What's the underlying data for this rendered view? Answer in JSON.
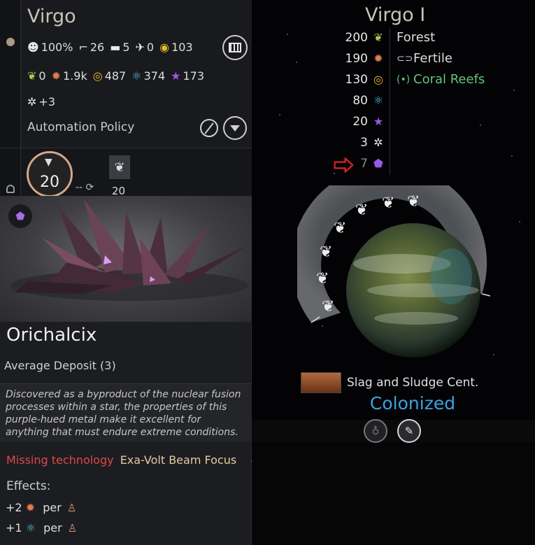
{
  "system": {
    "name": "Virgo",
    "stats_row1": {
      "approval": "100%",
      "land_units": "26",
      "tanks": "5",
      "air": "0",
      "influence_pool": "103"
    },
    "stats_row2": {
      "food": "0",
      "industry": "1.9k",
      "dust": "487",
      "science": "374",
      "influence": "173"
    },
    "stats_row3": {
      "stability": "+3"
    },
    "automation_label": "Automation Policy",
    "icons": [
      "approval-icon",
      "land-unit-icon",
      "tank-icon",
      "air-unit-icon",
      "influence-pool-icon",
      "construction-icon",
      "cancel-icon",
      "dropdown-icon"
    ]
  },
  "population": {
    "value": "20",
    "rate": "--",
    "faction_count": "20"
  },
  "resource": {
    "name": "Orichalcix",
    "deposit": "Average Deposit (3)",
    "description": "Discovered as a byproduct of the nuclear fusion processes within a star, the properties of this purple-hued metal make it excellent for anything that must endure extreme conditions.",
    "missing_label": "Missing technology",
    "missing_tech": "Exa-Volt Beam Focus",
    "effects_label": "Effects:",
    "effects": [
      {
        "amount": "+2",
        "resource_icon": "industry-icon",
        "per": "per"
      },
      {
        "amount": "+1",
        "resource_icon": "science-icon",
        "per": "per"
      }
    ]
  },
  "planet": {
    "name": "Virgo I",
    "yields": [
      {
        "value": "200",
        "icon": "food-icon",
        "color": "#a8c950"
      },
      {
        "value": "190",
        "icon": "industry-icon",
        "color": "#e07b52"
      },
      {
        "value": "130",
        "icon": "dust-icon",
        "color": "#e7b62d"
      },
      {
        "value": "80",
        "icon": "science-icon",
        "color": "#4ec2da"
      },
      {
        "value": "20",
        "icon": "influence-icon",
        "color": "#9a59e8"
      },
      {
        "value": "3",
        "icon": "stability-icon",
        "color": "#e8e8e8"
      },
      {
        "value": "7",
        "icon": "orichalcix-icon",
        "color": "#9a59e8"
      }
    ],
    "traits": [
      {
        "label": "Forest",
        "icon": "forest-icon"
      },
      {
        "label": "Fertile",
        "icon": "fish-icon"
      },
      {
        "label": "Coral Reefs",
        "icon": "coral-reefs-icon",
        "color": "#62c476"
      }
    ],
    "colony_name": "Slag and Sludge Cent.",
    "colony_status": "Colonized"
  },
  "colors": {
    "accent_blue": "#3aa3e0",
    "missing_red": "#e04848",
    "annotation_red": "#e02020",
    "coral_green": "#62c476"
  }
}
